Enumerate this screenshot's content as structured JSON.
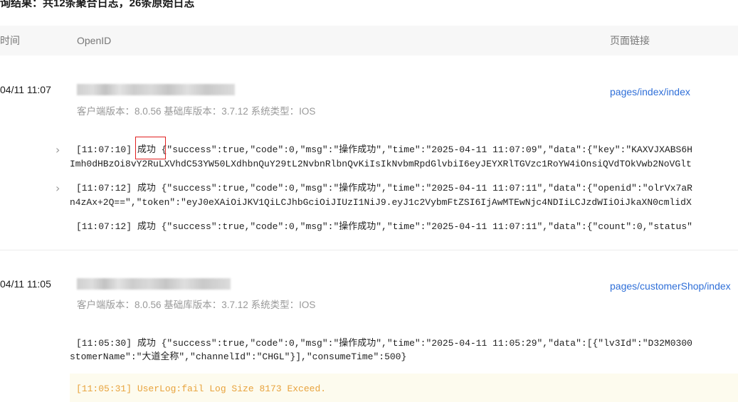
{
  "summary": "询结果：共12条聚合日志，26条原始日志",
  "table": {
    "headers": {
      "time": "时间",
      "openid": "OpenID",
      "page": "页面链接"
    }
  },
  "entries": [
    {
      "time": "04/11 11:07",
      "meta": "客户端版本：8.0.56 基础库版本：3.7.12 系统类型：IOS",
      "page": "pages/index/index",
      "logs": [
        {
          "line1": "[11:07:10] 成功 {\"success\":true,\"code\":0,\"msg\":\"操作成功\",\"time\":\"2025-04-11 11:07:09\",\"data\":{\"key\":\"KAXVJXABS6H",
          "line2": "Imh0dHBzOi8vY2RuLXVhdC53YW50LXdhbnQuY29tL2NvbnRlbnQvKiIsIkNvbmRpdGlvbiI6eyJEYXRlTGVzc1RoYW4iOnsiQVdTOkVwb2NoVGlt"
        },
        {
          "line1": "[11:07:12] 成功 {\"success\":true,\"code\":0,\"msg\":\"操作成功\",\"time\":\"2025-04-11 11:07:11\",\"data\":{\"openid\":\"olrVx7aR",
          "line2": "n4zAx+2Q==\",\"token\":\"eyJ0eXAiOiJKV1QiLCJhbGciOiJIUzI1NiJ9.eyJ1c2VybmFtZSI6IjAwMTEwNjc4NDIiLCJzdWIiOiJkaXN0cmlidX"
        },
        {
          "line1": "[11:07:12] 成功 {\"success\":true,\"code\":0,\"msg\":\"操作成功\",\"time\":\"2025-04-11 11:07:11\",\"data\":{\"count\":0,\"status\""
        }
      ]
    },
    {
      "time": "04/11 11:05",
      "meta": "客户端版本：8.0.56 基础库版本：3.7.12 系统类型：IOS",
      "page": "pages/customerShop/index",
      "logs": [
        {
          "line1": "[11:05:30] 成功 {\"success\":true,\"code\":0,\"msg\":\"操作成功\",\"time\":\"2025-04-11 11:05:29\",\"data\":[{\"lv3Id\":\"D32M0300",
          "line2": "stomerName\":\"大道全称\",\"channelId\":\"CHGL\"}],\"consumeTime\":500}"
        },
        {
          "line1": "[11:05:31] UserLog:fail Log Size 8173 Exceed."
        }
      ]
    }
  ],
  "icons": {
    "expand": "chevron-right-icon"
  },
  "colors": {
    "link": "#2f6fd8",
    "warn": "#e8a33d",
    "highlight_border": "#e02020"
  }
}
